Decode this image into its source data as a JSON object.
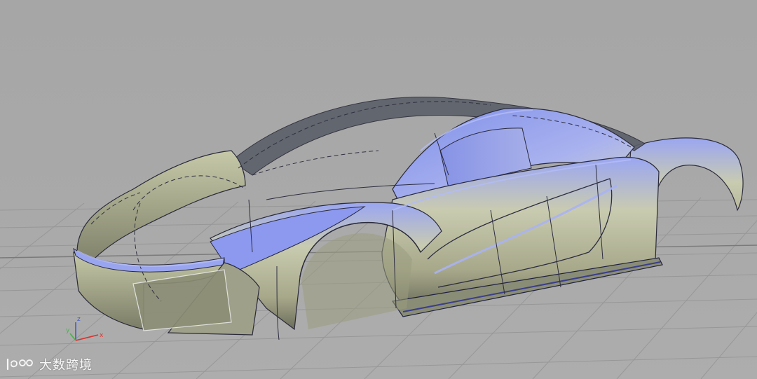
{
  "viewport": {
    "background_color": "#a9a9a9",
    "grid_color": "#8d8d8d",
    "surface_highlight_color": "#8f9ef0",
    "surface_base_color": "#c7c9a2",
    "surface_shadow_color": "#5e5f4e",
    "edge_color": "#2a2a3a"
  },
  "axis_triad": {
    "x_label": "x",
    "y_label": "y",
    "z_label": "z",
    "x_color": "#d9332e",
    "y_color": "#4caf50",
    "z_color": "#3d5bd8"
  },
  "watermark": {
    "logo_icon": "1800-logo-icon",
    "text": "大数跨境"
  }
}
